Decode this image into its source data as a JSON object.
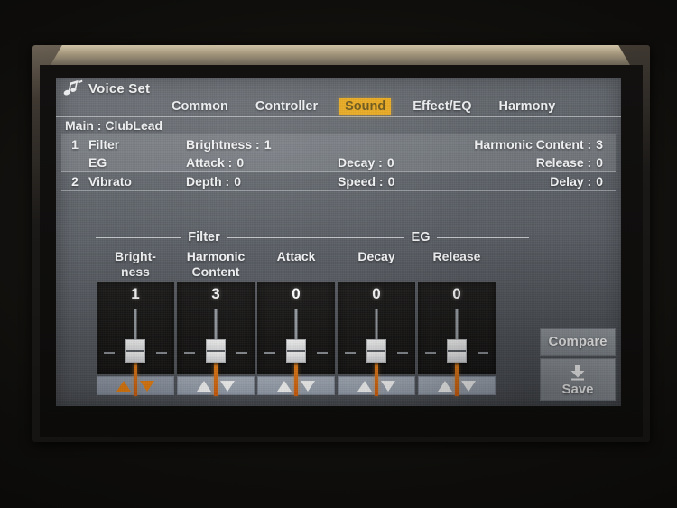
{
  "header": {
    "icon": "music-note-icon",
    "title": "Voice Set"
  },
  "tabs": [
    {
      "label": "Common",
      "active": false
    },
    {
      "label": "Controller",
      "active": false
    },
    {
      "label": "Sound",
      "active": true
    },
    {
      "label": "Effect/EQ",
      "active": false
    },
    {
      "label": "Harmony",
      "active": false
    }
  ],
  "summary": {
    "voice_line": "Main : ClubLead",
    "rows": [
      {
        "num": "1",
        "name": "Filter",
        "highlight": true,
        "p1_label": "Brightness :",
        "p1_value": "1",
        "p2_label": "",
        "p2_value": "",
        "p3_label": "Harmonic Content :",
        "p3_value": "3"
      },
      {
        "num": "",
        "name": "EG",
        "highlight": true,
        "p1_label": "Attack :",
        "p1_value": "0",
        "p2_label": "Decay :",
        "p2_value": "0",
        "p3_label": "Release :",
        "p3_value": "0"
      },
      {
        "num": "2",
        "name": "Vibrato",
        "highlight": false,
        "p1_label": "Depth :",
        "p1_value": "0",
        "p2_label": "Speed :",
        "p2_value": "0",
        "p3_label": "Delay :",
        "p3_value": "0"
      }
    ]
  },
  "groups": [
    {
      "label": "Filter"
    },
    {
      "label": "EG"
    }
  ],
  "sliders": [
    {
      "caption_line1": "Bright-",
      "caption_line2": "ness",
      "value": "1",
      "selected": true
    },
    {
      "caption_line1": "Harmonic",
      "caption_line2": "Content",
      "value": "3",
      "selected": false
    },
    {
      "caption_line1": "",
      "caption_line2": "Attack",
      "value": "0",
      "selected": false
    },
    {
      "caption_line1": "",
      "caption_line2": "Decay",
      "value": "0",
      "selected": false
    },
    {
      "caption_line1": "",
      "caption_line2": "Release",
      "value": "0",
      "selected": false
    }
  ],
  "side_actions": {
    "compare_label": "Compare",
    "save_label": "Save",
    "save_icon": "save-download-icon"
  },
  "colors": {
    "active_tab_bg": "#e9a91f",
    "slider_fill": "#f08a1c",
    "selected_arrow": "#f3840f",
    "lcd_bg": "#5f646a",
    "panel_bg": "#1d1c1b"
  }
}
